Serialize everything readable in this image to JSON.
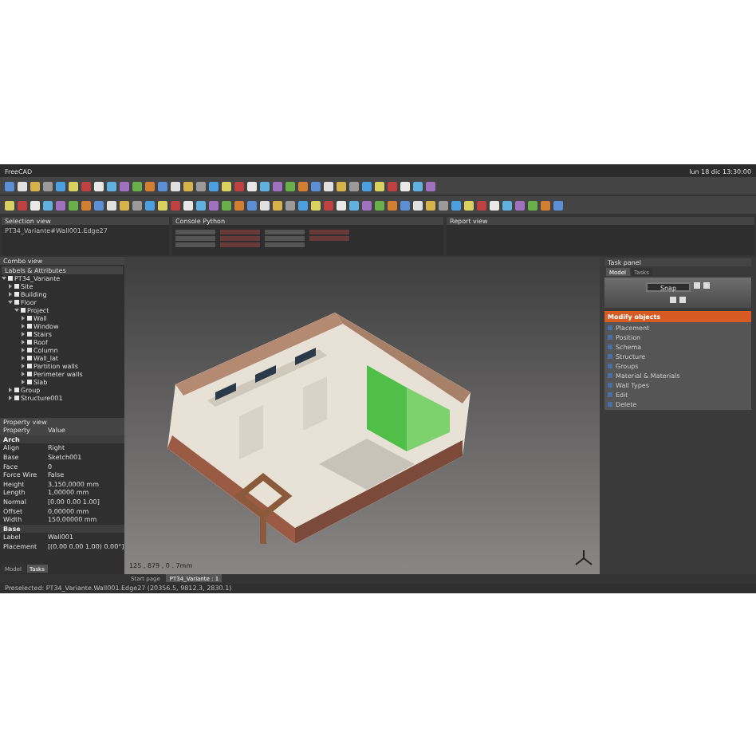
{
  "window": {
    "title": "FreeCAD",
    "clock": "lun 18 dic 13:30:00"
  },
  "selection_view": {
    "title": "Selection view",
    "text": "PT34_Variante#Wall001.Edge27"
  },
  "python_console": {
    "title": "Console Python"
  },
  "report_view": {
    "title": "Report view"
  },
  "tree": {
    "title": "Combo view",
    "header": "Labels & Attributes",
    "items": [
      {
        "label": "PT34_Variante",
        "expanded": true,
        "children": [
          {
            "label": "Site",
            "expanded": false
          },
          {
            "label": "Building",
            "expanded": false
          },
          {
            "label": "Floor",
            "expanded": true,
            "children": [
              {
                "label": "Project",
                "expanded": true,
                "children": [
                  {
                    "label": "Wall",
                    "expanded": false
                  },
                  {
                    "label": "Window",
                    "expanded": false
                  },
                  {
                    "label": "Stairs",
                    "expanded": false
                  },
                  {
                    "label": "Roof",
                    "expanded": false
                  },
                  {
                    "label": "Column",
                    "expanded": false
                  },
                  {
                    "label": "Wall_lat",
                    "expanded": false
                  },
                  {
                    "label": "Partition walls",
                    "expanded": false
                  },
                  {
                    "label": "Perimeter walls",
                    "expanded": false
                  },
                  {
                    "label": "Slab",
                    "expanded": false
                  }
                ]
              }
            ]
          },
          {
            "label": "Group",
            "expanded": false
          },
          {
            "label": "Structure001",
            "expanded": false
          }
        ]
      }
    ]
  },
  "properties": {
    "title": "Property view",
    "columns": [
      "Property",
      "Value"
    ],
    "rows": [
      {
        "kind": "group",
        "name": "Arch"
      },
      {
        "kind": "prop",
        "name": "Align",
        "value": "Right"
      },
      {
        "kind": "prop",
        "name": "Base",
        "value": "Sketch001"
      },
      {
        "kind": "prop",
        "name": "Face",
        "value": "0"
      },
      {
        "kind": "prop",
        "name": "Force Wire",
        "value": "False"
      },
      {
        "kind": "prop",
        "name": "Height",
        "value": "3,150,0000 mm"
      },
      {
        "kind": "prop",
        "name": "Length",
        "value": "1,00000 mm"
      },
      {
        "kind": "prop",
        "name": "Normal",
        "value": "[0.00 0.00 1.00]"
      },
      {
        "kind": "prop",
        "name": "Offset",
        "value": "0,00000 mm"
      },
      {
        "kind": "prop",
        "name": "Width",
        "value": "150,00000 mm"
      },
      {
        "kind": "group",
        "name": "Base"
      },
      {
        "kind": "prop",
        "name": "Label",
        "value": "Wall001"
      },
      {
        "kind": "prop",
        "name": "Placement",
        "value": "[(0.00 0.00 1.00) 0.00°]"
      }
    ],
    "tabs": [
      {
        "label": "Model",
        "selected": false
      },
      {
        "label": "Tasks",
        "selected": true
      }
    ]
  },
  "viewport": {
    "coordinates": "125 , 879 , 0 . 7mm"
  },
  "task_panel": {
    "title": "Task panel",
    "tabs": [
      {
        "label": "Model",
        "selected": true
      },
      {
        "label": "Tasks",
        "selected": false
      }
    ],
    "snap_button": "Snap",
    "section": "Modify objects",
    "items": [
      "Placement",
      "Position",
      "Schema",
      "Structure",
      "Groups",
      "Material & Materials",
      "Wall Types",
      "Edit",
      "Delete"
    ]
  },
  "doc_tabs": [
    {
      "label": "Start page",
      "selected": false
    },
    {
      "label": "PT34_Variante : 1",
      "selected": true
    }
  ],
  "status_bar": "Preselected: PT34_Variante.Wall001.Edge27 (20356.5, 9812.3, 2830.1)"
}
